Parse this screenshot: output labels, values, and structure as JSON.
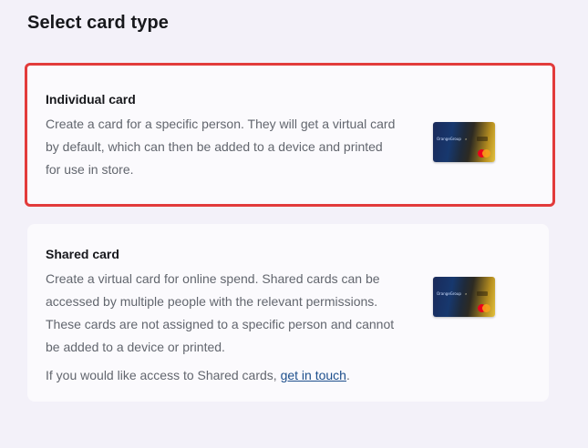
{
  "page": {
    "title": "Select card type"
  },
  "options": [
    {
      "heading": "Individual card",
      "description": "Create a card for a specific person. They will get a virtual card by default, which can then be added to a device and printed for use in store.",
      "selected": true,
      "image_brand": "OrangeGroup"
    },
    {
      "heading": "Shared card",
      "description": "Create a virtual card for online spend. Shared cards can be accessed by multiple people with the relevant permissions. These cards are not assigned to a specific person and cannot be added to a device or printed.",
      "note_prefix": "If you would like access to Shared cards, ",
      "note_link": "get in touch",
      "note_suffix": ".",
      "selected": false,
      "image_brand": "OrangeGroup"
    }
  ],
  "colors": {
    "background": "#f3f1f9",
    "card_background": "#fbfafd",
    "selected_border": "#e23b3b",
    "heading_text": "#17181c",
    "body_text": "#62666e",
    "link": "#1d4f8c"
  },
  "icons": {
    "card_network": "mastercard-icon"
  }
}
